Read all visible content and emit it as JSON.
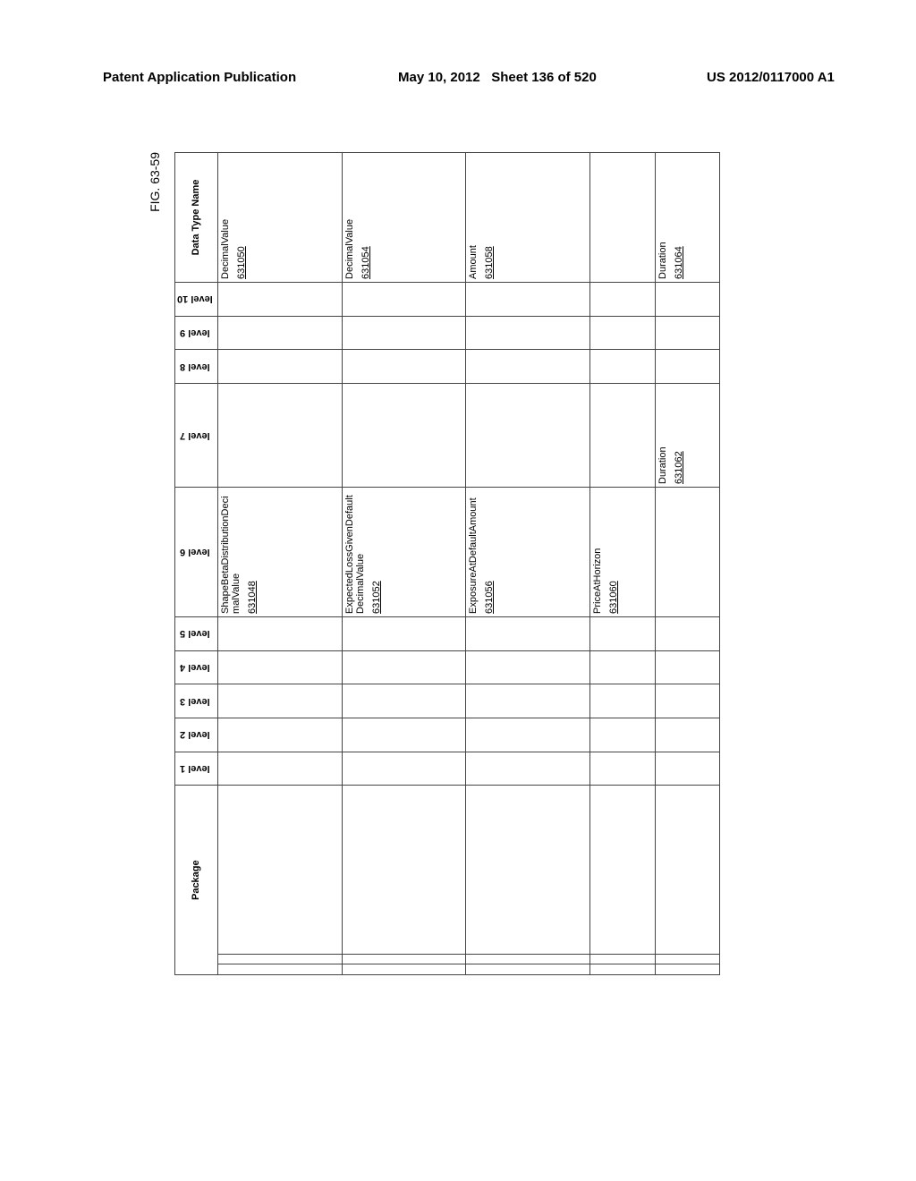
{
  "header": {
    "left": "Patent Application Publication",
    "date": "May 10, 2012",
    "sheet": "Sheet 136 of 520",
    "pubno": "US 2012/0117000 A1"
  },
  "figure_label": "FIG. 63-59",
  "table": {
    "headers": {
      "package": "Package",
      "l1": "level 1",
      "l2": "level 2",
      "l3": "level 3",
      "l4": "level 4",
      "l5": "level 5",
      "l6": "level 6",
      "l7": "level 7",
      "l8": "level 8",
      "l9": "level 9",
      "l10": "level 10",
      "dtn": "Data Type Name"
    },
    "rows": [
      {
        "l6": "ShapeBetaDistributionDecimalValue",
        "l6_ref": "631048",
        "dtn": "DecimalValue",
        "dtn_ref": "631050"
      },
      {
        "l6": "ExpectedLossGivenDefaultDecimalValue",
        "l6_ref": "631052",
        "dtn": "DecimalValue",
        "dtn_ref": "631054"
      },
      {
        "l6": "ExposureAtDefaultAmount",
        "l6_ref": "631056",
        "dtn": "Amount",
        "dtn_ref": "631058"
      },
      {
        "l6": "PriceAtHorizon",
        "l6_ref": "631060"
      },
      {
        "l7": "Duration",
        "l7_ref": "631062",
        "dtn": "Duration",
        "dtn_ref": "631064"
      }
    ]
  }
}
